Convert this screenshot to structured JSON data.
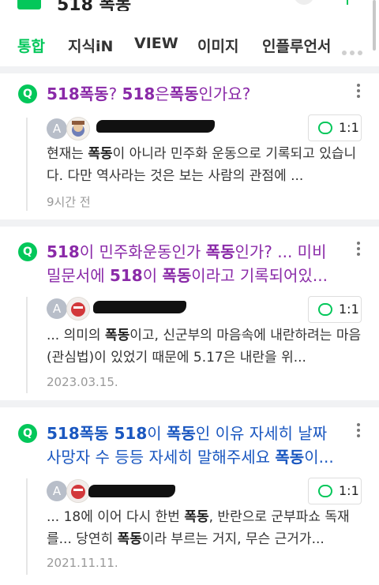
{
  "search": {
    "query": "518 폭동"
  },
  "tabs": [
    "통합",
    "지식iN",
    "VIEW",
    "이미지",
    "인플루언서"
  ],
  "results": [
    {
      "title_parts": [
        [
          "518폭동",
          true
        ],
        [
          "? ",
          false
        ],
        [
          "518",
          true
        ],
        [
          "은",
          false
        ],
        [
          "폭동",
          true
        ],
        [
          "인가요?",
          false
        ]
      ],
      "author_initial": "A",
      "answer_count": "1:1",
      "snippet_parts": [
        [
          "현재는 ",
          false
        ],
        [
          "폭동",
          true
        ],
        [
          "이 아니라 민주화 운동으로 기록되고 있습니다. 다만 역사라는 것은 보는 사람의 관점에 ...",
          false
        ]
      ],
      "date": "9시간 전"
    },
    {
      "title_parts": [
        [
          "518",
          true
        ],
        [
          "이 민주화운동인가 ",
          false
        ],
        [
          "폭동",
          true
        ],
        [
          "인가? ... 미비밀문서에 ",
          false
        ],
        [
          "518",
          true
        ],
        [
          "이 ",
          false
        ],
        [
          "폭동",
          true
        ],
        [
          "이라고 기록되어있...",
          false
        ]
      ],
      "author_initial": "A",
      "answer_count": "1:1",
      "snippet_parts": [
        [
          "... 의미의 ",
          false
        ],
        [
          "폭동",
          true
        ],
        [
          "이고, 신군부의 마음속에 내란하려는 마음(관심법)이 있었기 때문에 5.17은 내란을 위...",
          false
        ]
      ],
      "date": "2023.03.15."
    },
    {
      "title_parts": [
        [
          "518폭동 518",
          true
        ],
        [
          "이 ",
          false
        ],
        [
          "폭동",
          true
        ],
        [
          "인 이유 자세히 날짜 사망자 수 등등 자세히 말해주세요 ",
          false
        ],
        [
          "폭동",
          true
        ],
        [
          "이...",
          false
        ]
      ],
      "author_initial": "A",
      "answer_count": "1:1",
      "snippet_parts": [
        [
          "... 18에 이어 다시 한번 ",
          false
        ],
        [
          "폭동",
          true
        ],
        [
          ", 반란으로 군부파쇼 독재를... 당연히 ",
          false
        ],
        [
          "폭동",
          true
        ],
        [
          "이라 부르는 거지, 무슨 근거가...",
          false
        ]
      ],
      "date": "2021.11.11."
    }
  ],
  "colors": {
    "accent": "#03c75a",
    "visited_title": "#8a2aa8",
    "title": "#1a57c0"
  },
  "icons": [
    "naver-logo-icon",
    "mic-icon",
    "more-dots-icon",
    "q-badge-icon",
    "kebab-menu-icon",
    "chat-bubble-icon"
  ]
}
